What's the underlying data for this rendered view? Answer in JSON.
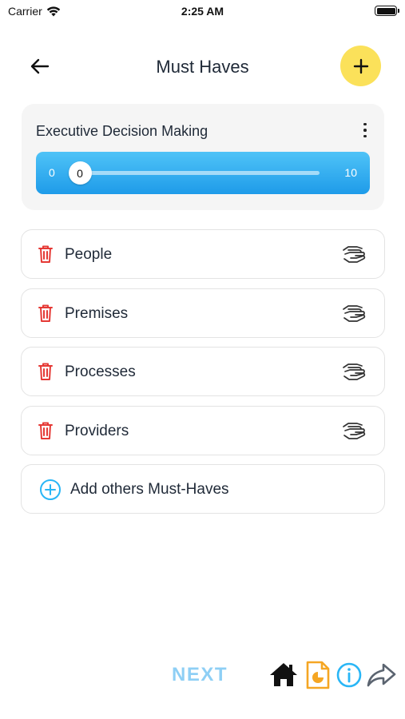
{
  "status_bar": {
    "carrier": "Carrier",
    "time": "2:25 AM"
  },
  "header": {
    "title": "Must Haves",
    "back_icon": "arrow-left-icon",
    "add_icon": "plus-icon"
  },
  "slider_card": {
    "title": "Executive Decision Making",
    "min_label": "0",
    "max_label": "10",
    "value": 0,
    "value_label": "0",
    "menu_icon": "more-vertical-icon",
    "gradient_colors": [
      "#4fc3f7",
      "#1e9be9"
    ]
  },
  "items": [
    {
      "label": "People",
      "delete_icon": "trash-icon",
      "action_icon": "handshake-icon"
    },
    {
      "label": "Premises",
      "delete_icon": "trash-icon",
      "action_icon": "handshake-icon"
    },
    {
      "label": "Processes",
      "delete_icon": "trash-icon",
      "action_icon": "handshake-icon"
    },
    {
      "label": "Providers",
      "delete_icon": "trash-icon",
      "action_icon": "handshake-icon"
    }
  ],
  "add_item": {
    "label": "Add others Must-Haves",
    "icon": "plus-circle-icon"
  },
  "footer": {
    "next_label": "NEXT",
    "icons": [
      "home-icon",
      "document-icon",
      "info-icon",
      "share-icon"
    ]
  },
  "colors": {
    "accent_yellow": "#fbe15a",
    "delete_red": "#e53935",
    "next_blue": "#8ecff5",
    "info_blue": "#29b6f6",
    "doc_orange": "#f5a623"
  }
}
